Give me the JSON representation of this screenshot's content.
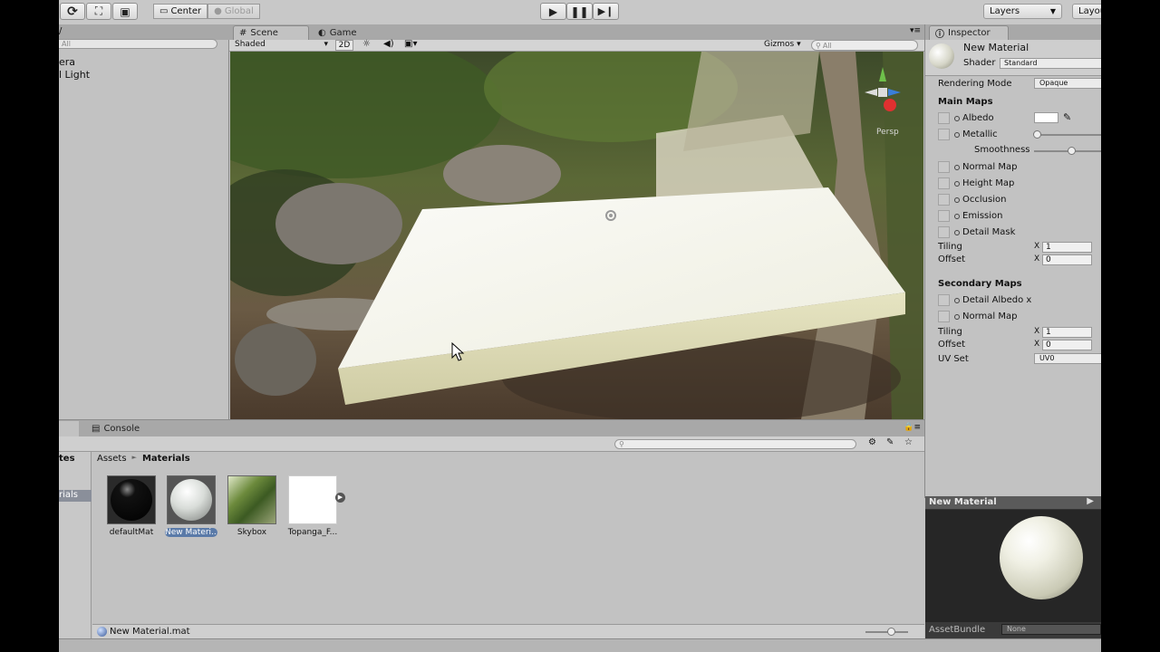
{
  "toolbar": {
    "center_label": "Center",
    "global_label": "Global",
    "layers_label": "Layers",
    "layout_label": "Layou"
  },
  "hierarchy": {
    "search_placeholder": "All",
    "items": [
      "era",
      "l Light"
    ]
  },
  "scene": {
    "tab_scene": "Scene",
    "tab_game": "Game",
    "shading": "Shaded",
    "mode_2d": "2D",
    "gizmos_label": "Gizmos",
    "search_placeholder": "All",
    "persp_label": "Persp"
  },
  "inspector": {
    "tab": "Inspector",
    "material_name": "New Material",
    "shader_label": "Shader",
    "shader_value": "Standard",
    "rendering_mode_label": "Rendering Mode",
    "rendering_mode_value": "Opaque",
    "main_maps": "Main Maps",
    "albedo": "Albedo",
    "metallic": "Metallic",
    "smoothness": "Smoothness",
    "normal_map": "Normal Map",
    "height_map": "Height Map",
    "occlusion": "Occlusion",
    "emission": "Emission",
    "detail_mask": "Detail Mask",
    "tiling": "Tiling",
    "offset": "Offset",
    "x": "X",
    "tiling_value": "1",
    "offset_value": "0",
    "secondary_maps": "Secondary Maps",
    "detail_albedo": "Detail Albedo x",
    "normal_map_2": "Normal Map",
    "tiling_2": "Tiling",
    "offset_2": "Offset",
    "tiling_value_2": "1",
    "offset_value_2": "0",
    "uv_set_label": "UV Set",
    "uv_set_value": "UV0",
    "metallic_level": 0.0,
    "smoothness_level": 0.5
  },
  "project": {
    "console_tab": "Console",
    "favorites_partial": "tes",
    "materials_partial": "rials",
    "breadcrumb_root": "Assets",
    "breadcrumb_sep": "►",
    "breadcrumb_current": "Materials",
    "assets": [
      {
        "label": "defaultMat"
      },
      {
        "label": "New Materi..."
      },
      {
        "label": "Skybox"
      },
      {
        "label": "Topanga_F..."
      }
    ],
    "selected_file": "New Material.mat"
  },
  "preview": {
    "title": "New Material",
    "assetbundle_label": "AssetBundle",
    "assetbundle_value": "None"
  }
}
